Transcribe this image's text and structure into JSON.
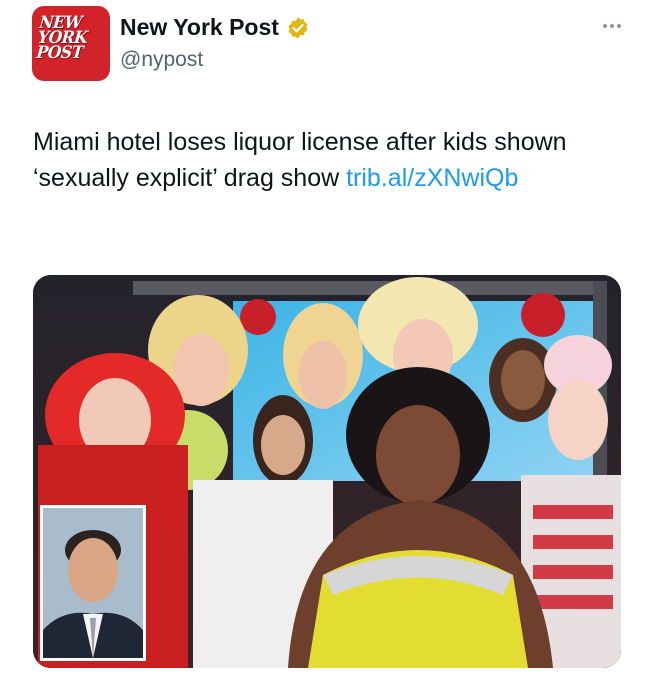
{
  "account": {
    "display_name": "New York Post",
    "handle": "@nypost",
    "avatar_logo_lines": [
      "NEW",
      "YORK",
      "POST"
    ],
    "verified": true,
    "verified_icon": "gold-checkmark-badge-icon",
    "brand_color": "#d2232a"
  },
  "more_menu_icon": "more-horizontal-icon",
  "tweet": {
    "text": "Miami hotel loses liquor license after kids shown ‘sexually explicit’ drag show ",
    "link_text": "trib.al/​zXNwiQb"
  },
  "colors": {
    "link": "#1d9bf0",
    "handle": "#536471"
  }
}
